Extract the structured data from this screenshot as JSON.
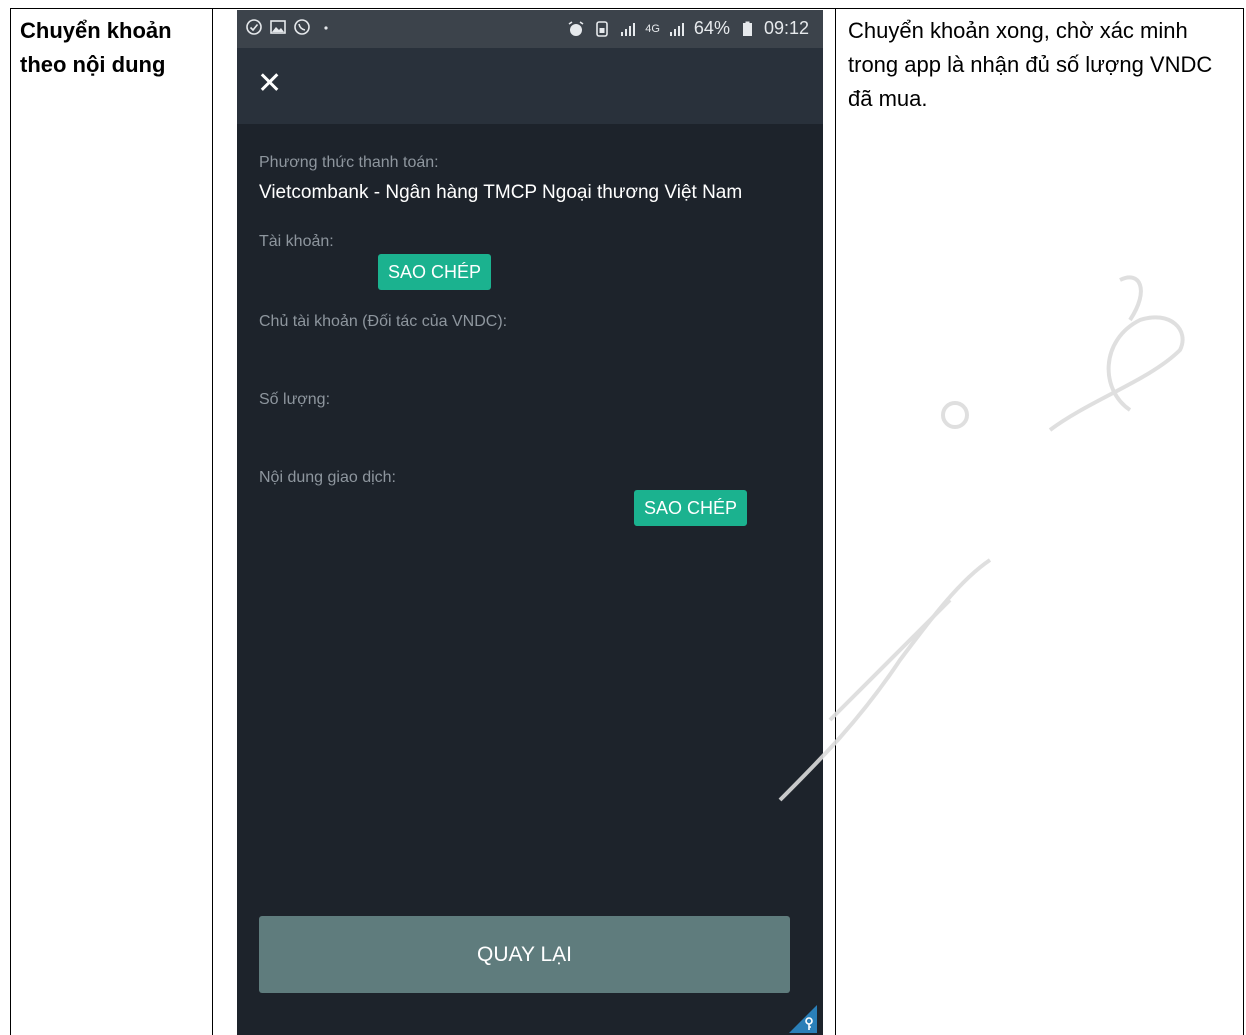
{
  "left_cell": {
    "line1": "Chuyển khoản",
    "line2": "theo nội dung"
  },
  "right_cell": {
    "note": "Chuyển khoản xong, chờ xác minh trong app là nhận đủ số lượng VNDC đã mua."
  },
  "status_bar": {
    "battery": "64%",
    "time": "09:12",
    "network": "4G",
    "left_icons": [
      "check-circle-icon",
      "image-icon",
      "viber-icon",
      "dot-icon"
    ],
    "right_icons": [
      "alarm-icon",
      "sim-icon",
      "signal-icon",
      "signal-icon",
      "battery-icon"
    ]
  },
  "app": {
    "close_icon": "close-icon",
    "payment_method": {
      "label": "Phương thức thanh toán:",
      "value": "Vietcombank - Ngân hàng TMCP Ngoại thương Việt Nam"
    },
    "account": {
      "label": "Tài khoản:",
      "copy_label": "SAO CHÉP"
    },
    "owner": {
      "label": "Chủ tài khoản (Đối tác của VNDC):"
    },
    "amount": {
      "label": "Số lượng:"
    },
    "content": {
      "label": "Nội dung giao dịch:",
      "copy_label": "SAO CHÉP"
    },
    "back_label": "QUAY LẠI"
  },
  "colors": {
    "phone_bg": "#1d232b",
    "header_bg": "#29313b",
    "status_bg": "#3c434b",
    "accent": "#1bb28f",
    "back_button": "#5f7c7d"
  }
}
